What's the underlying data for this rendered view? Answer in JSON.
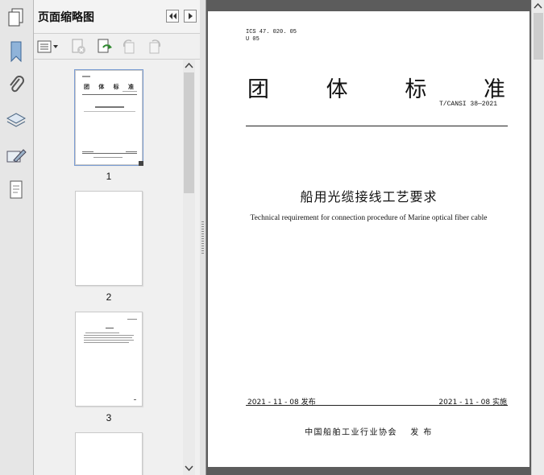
{
  "thumbnails_panel": {
    "title": "页面缩略图",
    "thumbnails": [
      {
        "page_label": "1"
      },
      {
        "page_label": "2"
      },
      {
        "page_label": "3"
      }
    ]
  },
  "document": {
    "ics_code": "ICS 47. 020. 05",
    "class_code": "U 05",
    "header_chars": [
      "团",
      "体",
      "标",
      "准"
    ],
    "standard_number": "T/CANSI 38—2021",
    "title_zh": "船用光缆接线工艺要求",
    "title_en": "Technical requirement for connection procedure of Marine optical fiber cable",
    "release_date": "2021 - 11 - 08 发布",
    "implement_date": "2021 - 11 - 08 实施",
    "publisher": "中国船舶工业行业协会　 发 布"
  }
}
